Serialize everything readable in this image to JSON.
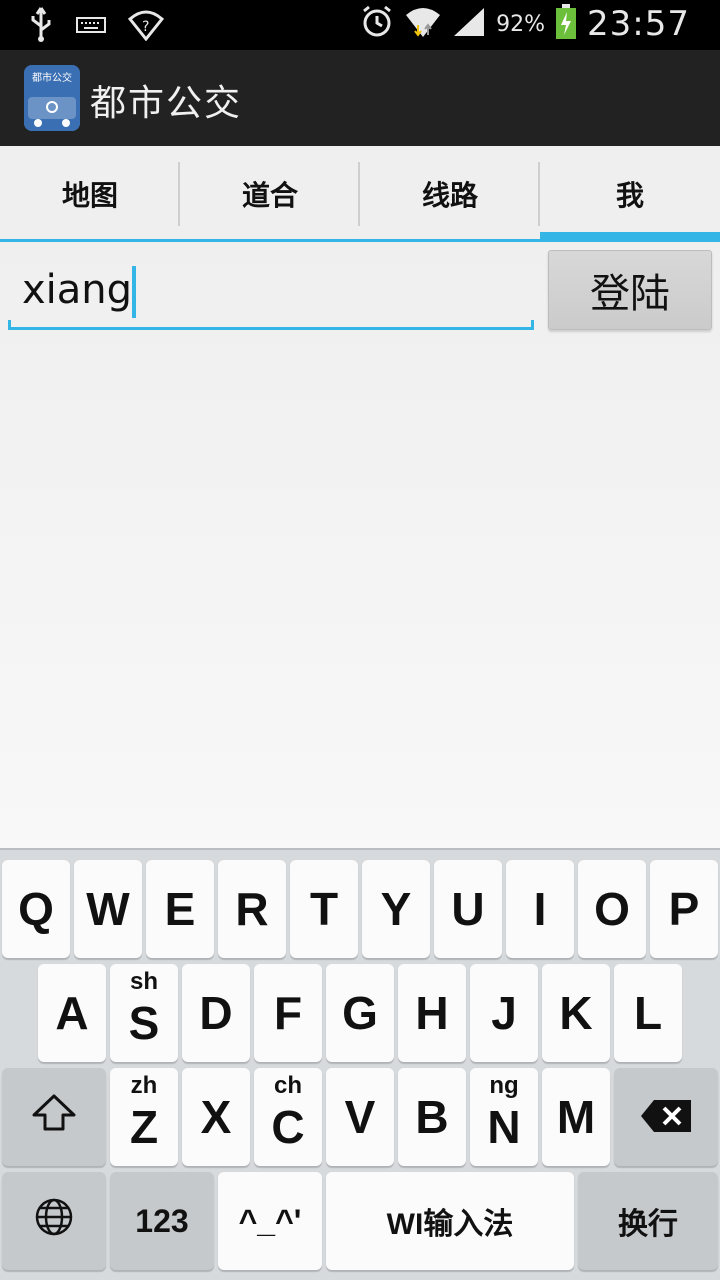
{
  "status_bar": {
    "battery": "92%",
    "time": "23:57"
  },
  "action_bar": {
    "title": "都市公交",
    "logo_text": "都市公交"
  },
  "tabs": [
    {
      "label": "地图",
      "active": false
    },
    {
      "label": "道合",
      "active": false
    },
    {
      "label": "线路",
      "active": false
    },
    {
      "label": "我",
      "active": true
    }
  ],
  "login_form": {
    "username_value": "xiang",
    "login_label": "登陆"
  },
  "keyboard": {
    "row1": [
      "Q",
      "W",
      "E",
      "R",
      "T",
      "Y",
      "U",
      "I",
      "O",
      "P"
    ],
    "row2": [
      "A",
      "S",
      "D",
      "F",
      "G",
      "H",
      "J",
      "K",
      "L"
    ],
    "row2_hints": {
      "S": "sh"
    },
    "row3": [
      "Z",
      "X",
      "C",
      "V",
      "B",
      "N",
      "M"
    ],
    "row3_hints": {
      "Z": "zh",
      "C": "ch",
      "N": "ng"
    },
    "numbers_label": "123",
    "emoticon_label": "^_^'",
    "space_label": "WI输入法",
    "enter_label": "换行"
  },
  "colors": {
    "accent": "#33b5e5",
    "action_bar": "#222222",
    "status_bar": "#000000"
  }
}
